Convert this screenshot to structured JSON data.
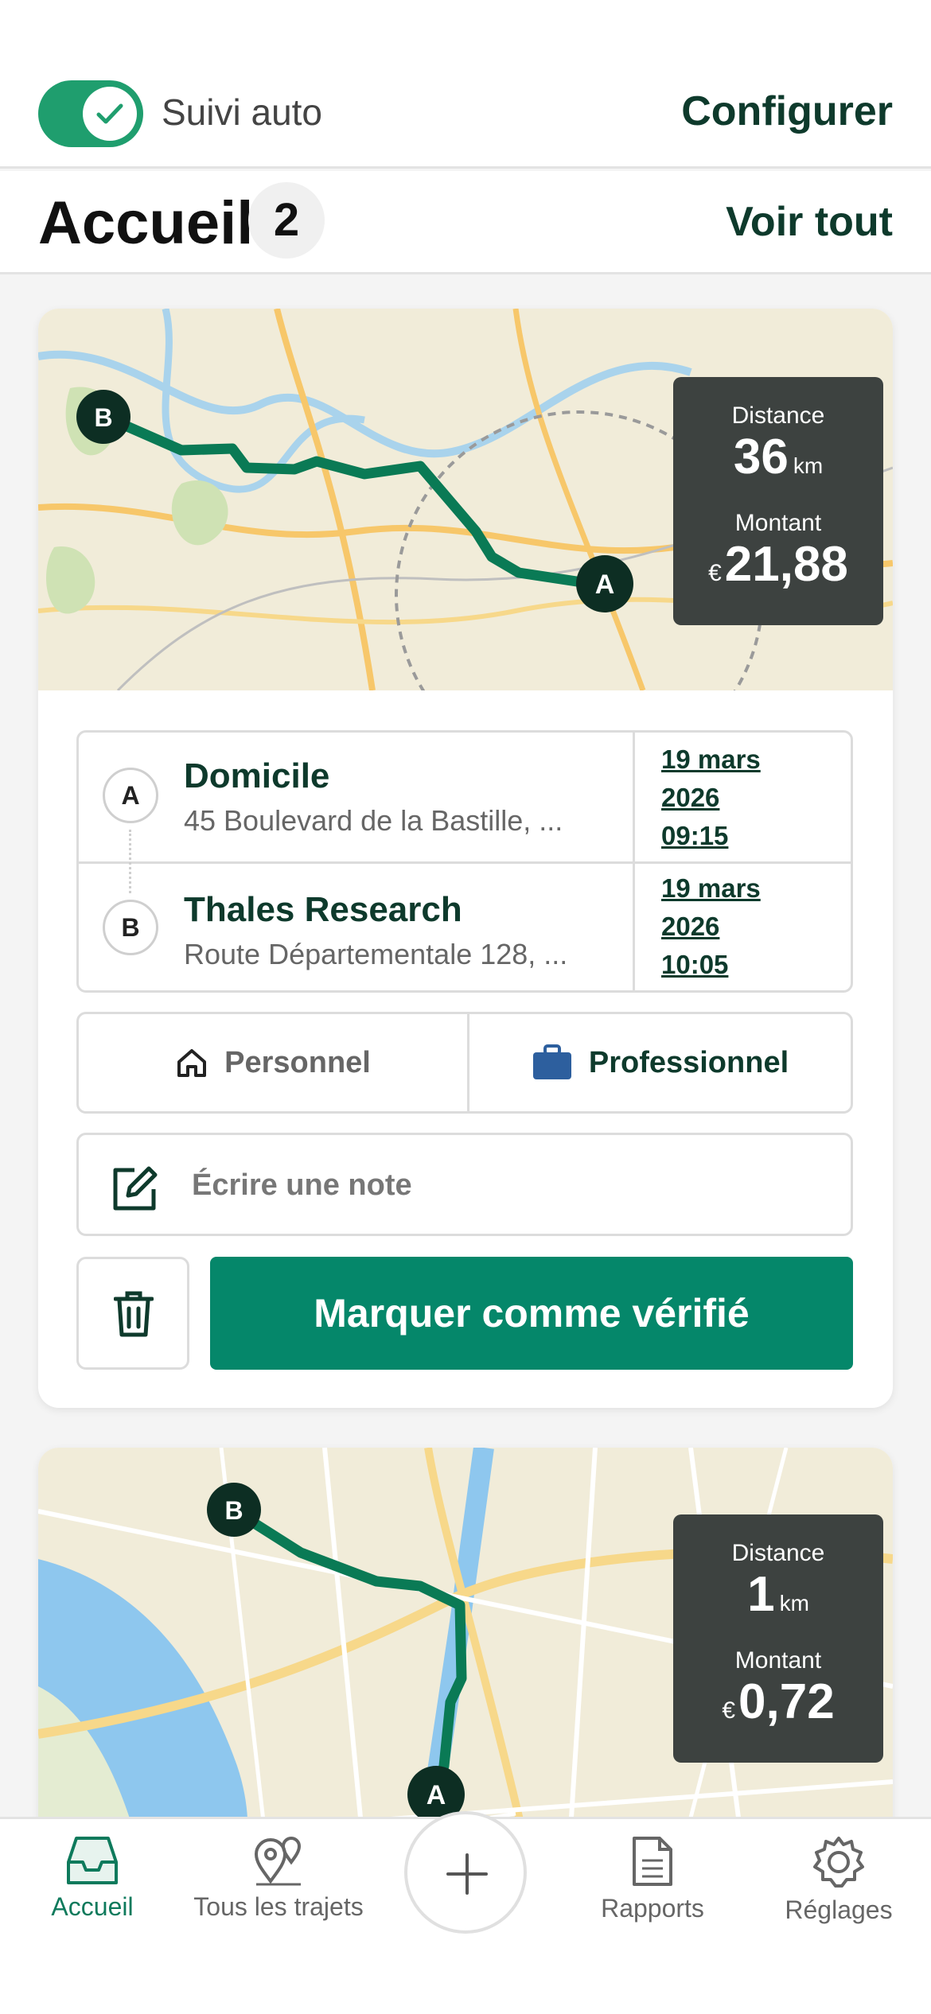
{
  "top_bar": {
    "auto_tracking_label": "Suivi auto",
    "auto_tracking_on": true,
    "configure_label": "Configurer"
  },
  "header": {
    "title": "Accueil",
    "count": "2",
    "see_all_label": "Voir tout"
  },
  "trips": [
    {
      "distance_label": "Distance",
      "distance_value": "36",
      "distance_unit": "km",
      "amount_label": "Montant",
      "amount_currency": "€",
      "amount_value": "21,88",
      "start": {
        "marker": "A",
        "name": "Domicile",
        "address": "45 Boulevard de la Bastille, ...",
        "date_line1": "19 mars",
        "date_line2": "2026",
        "time": "09:15"
      },
      "end": {
        "marker": "B",
        "name": "Thales Research",
        "address": "Route Départementale 128, ...",
        "date_line1": "19 mars",
        "date_line2": "2026",
        "time": "10:05"
      },
      "category_personal": "Personnel",
      "category_professional": "Professionnel",
      "selected_category": "Professionnel",
      "note_placeholder": "Écrire une note",
      "verify_label": "Marquer comme vérifié"
    },
    {
      "distance_label": "Distance",
      "distance_value": "1",
      "distance_unit": "km",
      "amount_label": "Montant",
      "amount_currency": "€",
      "amount_value": "0,72",
      "start_marker": "A",
      "end_marker": "B"
    }
  ],
  "tab_bar": {
    "home": "Accueil",
    "all_trips": "Tous les trajets",
    "reports": "Rapports",
    "settings": "Réglages",
    "active": "Accueil"
  },
  "colors": {
    "brand_green": "#05876a",
    "toggle_green": "#1f9e6e",
    "dark_green_text": "#0e3a2c",
    "route_line": "#0a7a55",
    "stats_bg": "#3d4240",
    "briefcase_blue": "#2d5f9e"
  },
  "icons": {
    "toggle": "check-icon",
    "personal": "home-icon",
    "professional": "briefcase-icon",
    "note": "edit-note-icon",
    "delete": "trash-icon",
    "tab_home": "inbox-tray-icon",
    "tab_trips": "map-pins-icon",
    "tab_add": "plus-icon",
    "tab_reports": "document-icon",
    "tab_settings": "gear-icon"
  }
}
